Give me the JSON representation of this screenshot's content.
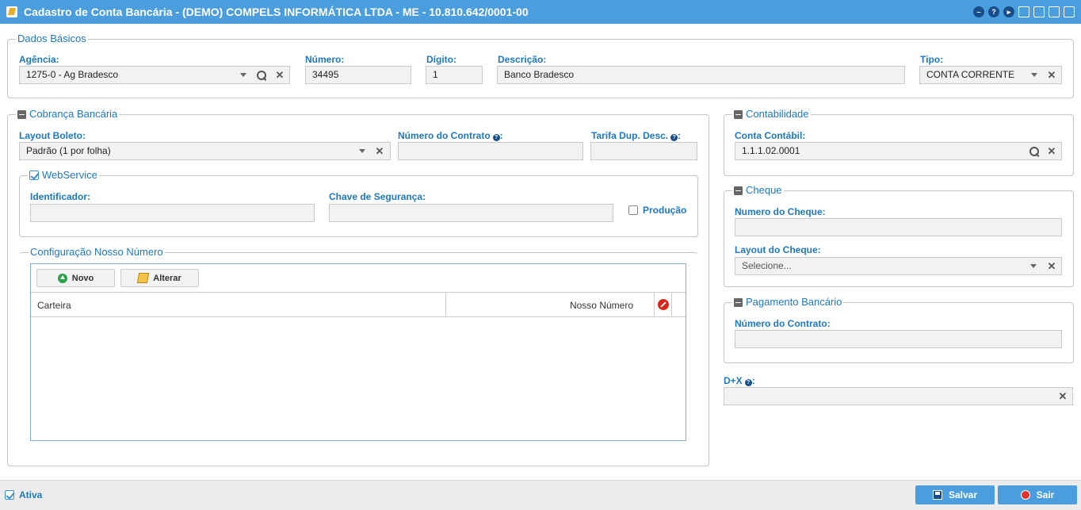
{
  "window": {
    "title": "Cadastro de Conta Bancária - (DEMO) COMPELS INFORMÁTICA LTDA - ME - 10.810.642/0001-00"
  },
  "dados_basicos": {
    "legend": "Dados Básicos",
    "agencia_label": "Agência:",
    "agencia_value": "1275-0 - Ag Bradesco",
    "numero_label": "Número:",
    "numero_value": "34495",
    "digito_label": "Dígito:",
    "digito_value": "1",
    "descricao_label": "Descrição:",
    "descricao_value": "Banco Bradesco",
    "tipo_label": "Tipo:",
    "tipo_value": "CONTA CORRENTE"
  },
  "cobranca": {
    "legend": "Cobrança Bancária",
    "layout_boleto_label": "Layout Boleto:",
    "layout_boleto_value": "Padrão (1 por folha)",
    "numero_contrato_label": "Número do Contrato",
    "tarifa_label": "Tarifa Dup. Desc.",
    "webservice": {
      "legend": "WebService",
      "identificador_label": "Identificador:",
      "chave_label": "Chave de Segurança:",
      "producao_label": "Produção"
    },
    "nosso_numero": {
      "legend": "Configuração Nosso Número",
      "novo_label": "Novo",
      "alterar_label": "Alterar",
      "col_carteira": "Carteira",
      "col_nosso_numero": "Nosso Número"
    }
  },
  "contabilidade": {
    "legend": "Contabilidade",
    "conta_label": "Conta Contábil:",
    "conta_value": "1.1.1.02.0001"
  },
  "cheque": {
    "legend": "Cheque",
    "numero_label": "Numero do Cheque:",
    "layout_label": "Layout do Cheque:",
    "layout_placeholder": "Selecione..."
  },
  "pagamento": {
    "legend": "Pagamento Bancário",
    "contrato_label": "Número do Contrato:"
  },
  "dx": {
    "label": "D+X"
  },
  "footer": {
    "ativa_label": "Ativa",
    "salvar_label": "Salvar",
    "sair_label": "Sair"
  },
  "icons": {
    "title": "edit-icon",
    "save": "save-icon",
    "exit": "exit-icon"
  },
  "colors": {
    "titlebar": "#4a9ede",
    "label": "#1e78c2"
  }
}
